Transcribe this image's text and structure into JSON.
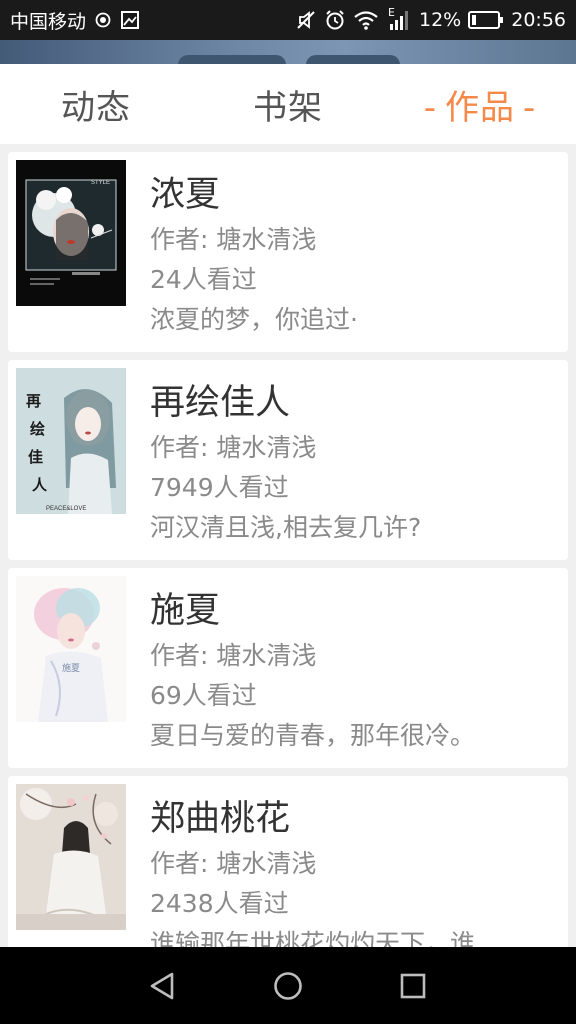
{
  "status_bar": {
    "carrier": "中国移动",
    "battery": "12%",
    "time": "20:56",
    "network_type": "E"
  },
  "tabs": [
    {
      "label": "动态",
      "active": false
    },
    {
      "label": "书架",
      "active": false
    },
    {
      "label": "作品",
      "active": true
    }
  ],
  "active_dash": "-",
  "books": [
    {
      "title": "浓夏",
      "author": "作者: 塘水清浅",
      "views": "24人看过",
      "intro": "浓夏的梦，你追过·",
      "cover_text": "STYLE"
    },
    {
      "title": "再绘佳人",
      "author": "作者: 塘水清浅",
      "views": "7949人看过",
      "intro": "河汉清且浅,相去复几许?",
      "cover_text": "再绘佳人",
      "cover_footer": "PEACE&LOVE"
    },
    {
      "title": "施夏",
      "author": "作者: 塘水清浅",
      "views": "69人看过",
      "intro": "夏日与爱的青春，那年很冷。",
      "cover_text": "施夏"
    },
    {
      "title": "郑曲桃花",
      "author": "作者: 塘水清浅",
      "views": "2438人看过",
      "intro": "谁输那年世桃花灼灼天下，谁"
    }
  ],
  "colors": {
    "accent": "#f5894a",
    "tab_inactive": "#555555",
    "meta_text": "#8a8a8a"
  }
}
